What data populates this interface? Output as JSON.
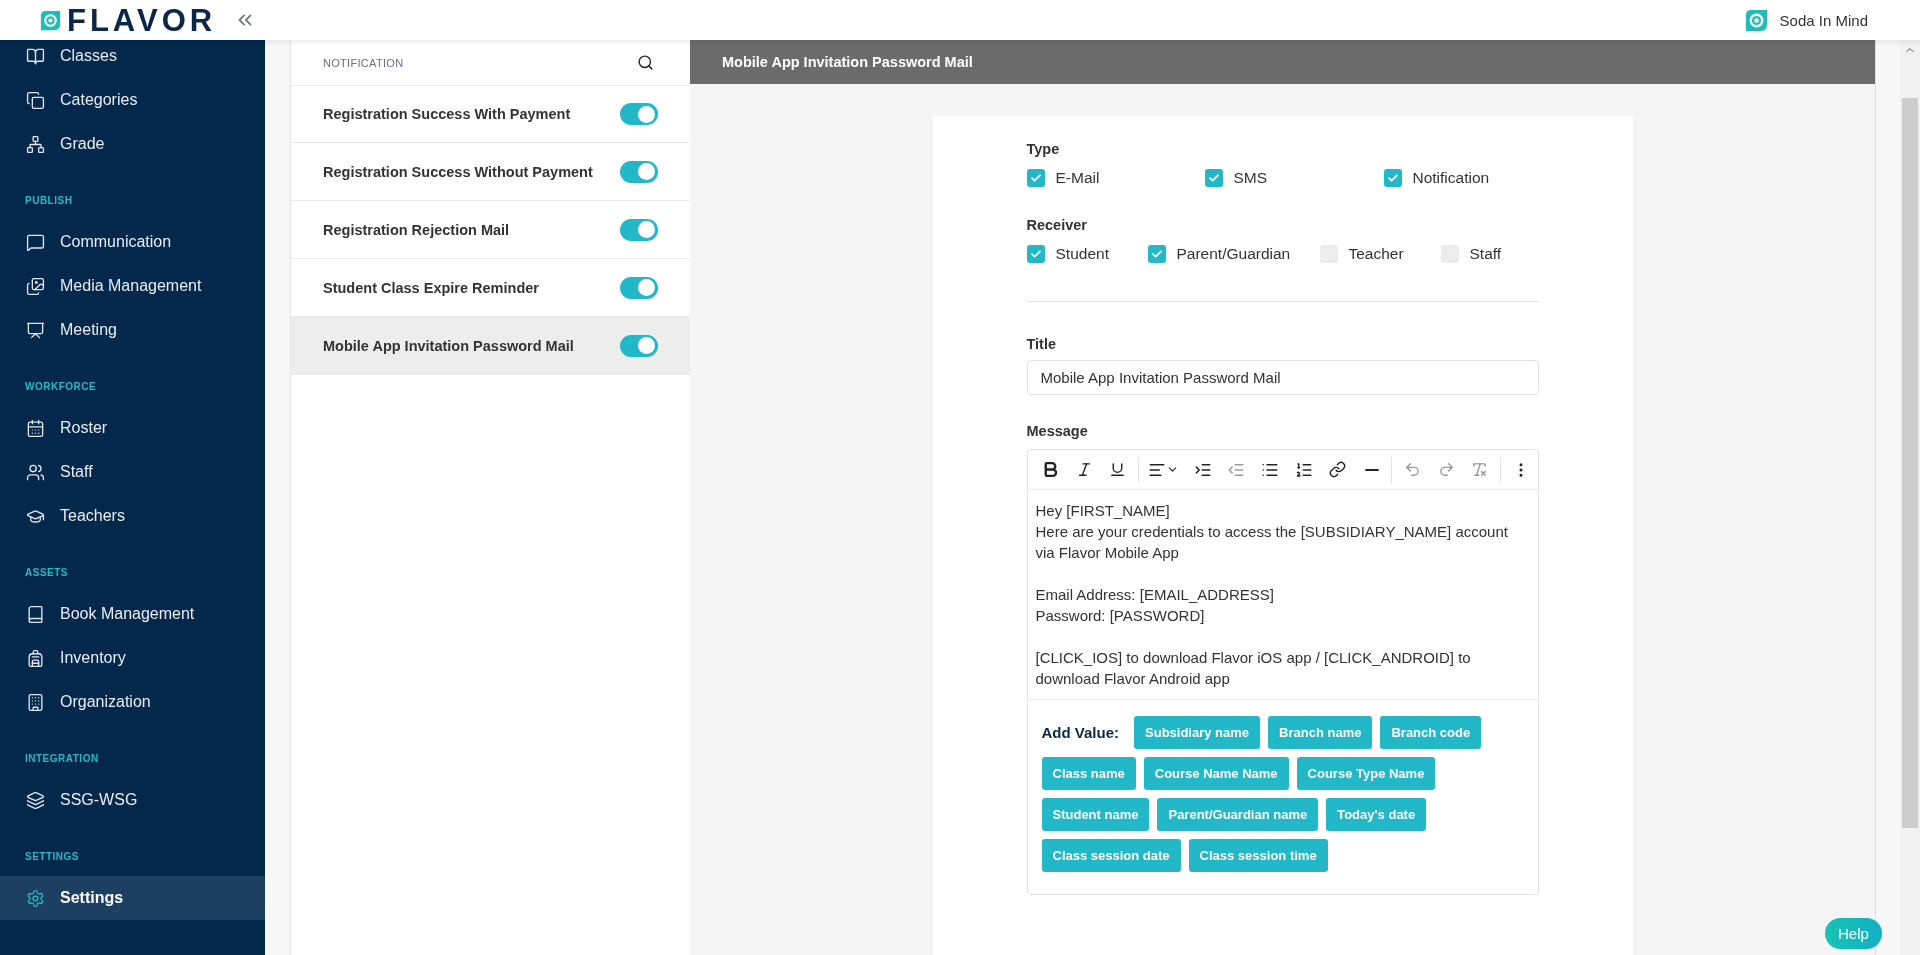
{
  "header": {
    "logo_text": "FLAVOR",
    "account": "Soda In Mind"
  },
  "sidebar": {
    "sections": [
      {
        "items": [
          {
            "label": "Classes",
            "selected": false
          },
          {
            "label": "Categories",
            "selected": false
          },
          {
            "label": "Grade",
            "selected": false
          }
        ]
      },
      {
        "label": "PUBLISH",
        "items": [
          {
            "label": "Communication",
            "selected": false
          },
          {
            "label": "Media Management",
            "selected": false
          },
          {
            "label": "Meeting",
            "selected": false
          }
        ]
      },
      {
        "label": "WORKFORCE",
        "items": [
          {
            "label": "Roster",
            "selected": false
          },
          {
            "label": "Staff",
            "selected": false
          },
          {
            "label": "Teachers",
            "selected": false
          }
        ]
      },
      {
        "label": "ASSETS",
        "items": [
          {
            "label": "Book Management",
            "selected": false
          },
          {
            "label": "Inventory",
            "selected": false
          },
          {
            "label": "Organization",
            "selected": false
          }
        ]
      },
      {
        "label": "INTEGRATION",
        "items": [
          {
            "label": "SSG-WSG",
            "selected": false
          }
        ]
      },
      {
        "label": "SETTINGS",
        "items": [
          {
            "label": "Settings",
            "selected": true
          }
        ]
      }
    ]
  },
  "notifications": {
    "heading": "NOTIFICATION",
    "items": [
      {
        "label": "Registration Success With Payment",
        "on": true,
        "selected": false
      },
      {
        "label": "Registration Success Without Payment",
        "on": true,
        "selected": false
      },
      {
        "label": "Registration Rejection Mail",
        "on": true,
        "selected": false
      },
      {
        "label": "Student Class Expire Reminder",
        "on": true,
        "selected": false
      },
      {
        "label": "Mobile App Invitation Password Mail",
        "on": true,
        "selected": true
      }
    ]
  },
  "detail": {
    "title": "Mobile App Invitation Password Mail",
    "groups": [
      {
        "label": "Type",
        "options": [
          {
            "label": "E-Mail",
            "checked": true
          },
          {
            "label": "SMS",
            "checked": true
          },
          {
            "label": "Notification",
            "checked": true
          }
        ]
      },
      {
        "label": "Receiver",
        "options": [
          {
            "label": "Student",
            "checked": true
          },
          {
            "label": "Parent/Guardian",
            "checked": true
          },
          {
            "label": "Teacher",
            "checked": false
          },
          {
            "label": "Staff",
            "checked": false
          }
        ]
      }
    ],
    "title_field": {
      "label": "Title",
      "value": "Mobile App Invitation Password Mail"
    },
    "message": {
      "label": "Message",
      "paragraphs": [
        [
          "Hey [FIRST_NAME]",
          "Here are your credentials to access the [SUBSIDIARY_NAME] account via Flavor Mobile App"
        ],
        [
          "Email Address: [EMAIL_ADDRESS]",
          "Password: [PASSWORD]"
        ],
        [
          "[CLICK_IOS] to download Flavor iOS app / [CLICK_ANDROID] to download Flavor Android app"
        ]
      ],
      "add_value_label": "Add Value:",
      "values": [
        "Subsidiary name",
        "Branch name",
        "Branch code",
        "Class name",
        "Course Name Name",
        "Course Type Name",
        "Student name",
        "Parent/Guardian name",
        "Today's date",
        "Class session date",
        "Class session time"
      ]
    }
  },
  "help_button": "Help"
}
